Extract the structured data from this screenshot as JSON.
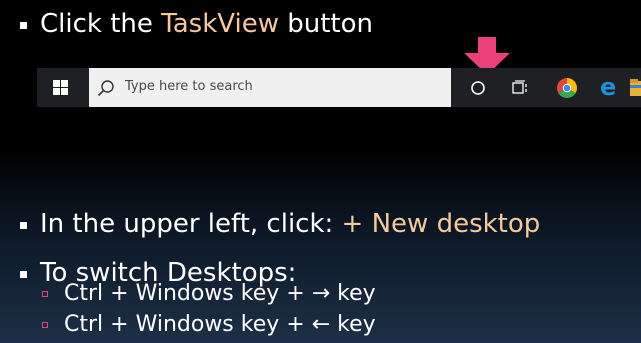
{
  "step1": {
    "prefix": "Click the ",
    "highlight": "TaskView",
    "suffix": " button"
  },
  "taskbar": {
    "search_placeholder": "Type here to search"
  },
  "step2": {
    "prefix": "In the upper left, click: ",
    "highlight": "+ New desktop"
  },
  "step3": {
    "title": "To switch Desktops:",
    "items": [
      "Ctrl + Windows key + → key",
      "Ctrl + Windows key + ← key"
    ]
  },
  "colors": {
    "accent": "#f6c99a",
    "arrow": "#e9407a",
    "sub_bullet": "#e0457b",
    "taskbar": "#1f2023"
  },
  "icons": [
    "windows-start-icon",
    "search-icon",
    "cortana-icon",
    "task-view-icon",
    "chrome-icon",
    "edge-icon",
    "file-explorer-icon",
    "down-arrow-icon"
  ]
}
